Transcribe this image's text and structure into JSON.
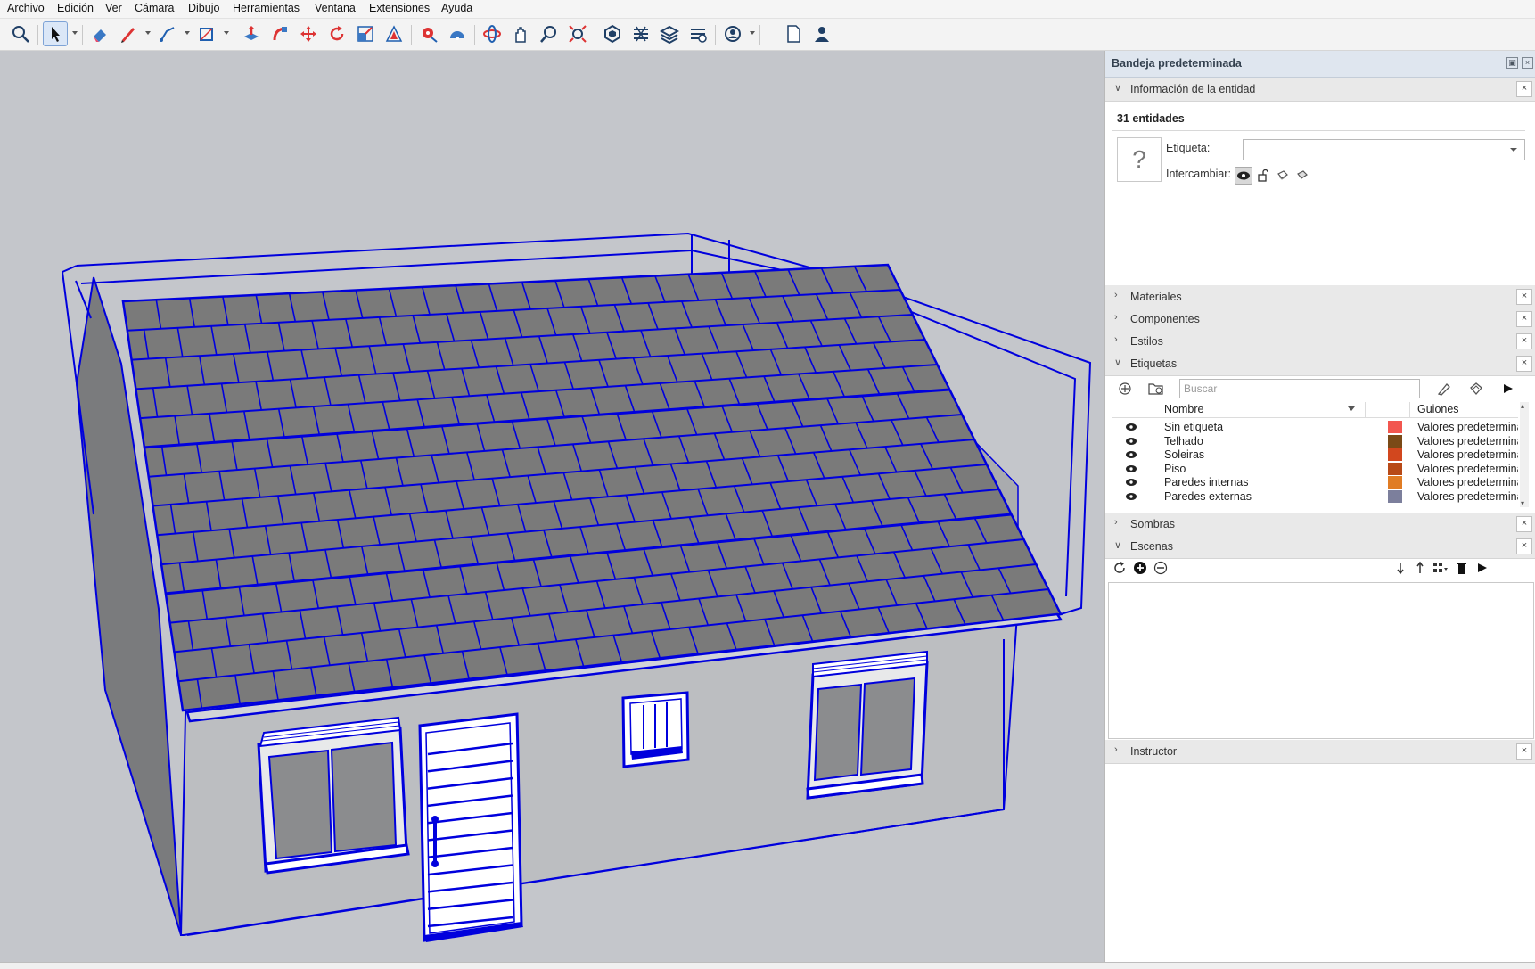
{
  "menu": [
    "Archivo",
    "Edición",
    "Ver",
    "Cámara",
    "Dibujo",
    "Herramientas",
    "Ventana",
    "Extensiones",
    "Ayuda"
  ],
  "toolbar": {
    "icons": [
      "search-icon",
      "select-arrow-icon",
      "eraser-icon",
      "pencil-icon",
      "line-tool-icon",
      "rectangle-icon",
      "push-pull-icon",
      "follow-me-icon",
      "move-icon",
      "rotate-icon",
      "scale-icon",
      "offset-icon",
      "tape-measure-icon",
      "protractor-icon",
      "orbit-icon",
      "pan-icon",
      "zoom-icon",
      "zoom-extents-icon",
      "3d-warehouse-icon",
      "extension-warehouse-icon",
      "layout-icon",
      "dimension-icon",
      "profile-icon",
      "new-file-icon",
      "user-icon"
    ]
  },
  "tray": {
    "title": "Bandeja predeterminada",
    "entity_info": {
      "label": "Información de la entidad",
      "count": "31 entidades",
      "unknown_symbol": "?",
      "tag_label": "Etiqueta:",
      "tag_value": "",
      "swap_label": "Intercambiar:"
    },
    "sections": {
      "materiales": "Materiales",
      "componentes": "Componentes",
      "estilos": "Estilos",
      "etiquetas": "Etiquetas",
      "sombras": "Sombras",
      "escenas": "Escenas",
      "instructor": "Instructor"
    },
    "tags": {
      "search_placeholder": "Buscar",
      "col_name": "Nombre",
      "col_dashes": "Guiones",
      "rows": [
        {
          "name": "Sin etiqueta",
          "color": "#f2564f",
          "dashes": "Valores predeterminados"
        },
        {
          "name": "Telhado",
          "color": "#7a4a17",
          "dashes": "Valores predeterminados"
        },
        {
          "name": "Soleiras",
          "color": "#d2471e",
          "dashes": "Valores predeterminados"
        },
        {
          "name": "Piso",
          "color": "#b84a17",
          "dashes": "Valores predeterminados"
        },
        {
          "name": "Paredes internas",
          "color": "#e07c24",
          "dashes": "Valores predeterminados"
        },
        {
          "name": "Paredes externas",
          "color": "#7c7f9c",
          "dashes": "Valores predeterminados"
        }
      ]
    }
  },
  "colors": {
    "selection": "#0000dd",
    "roof_tile": "#7a7a7a",
    "wall": "#bcbec1",
    "viewport_bg": "#c4c6cb"
  }
}
